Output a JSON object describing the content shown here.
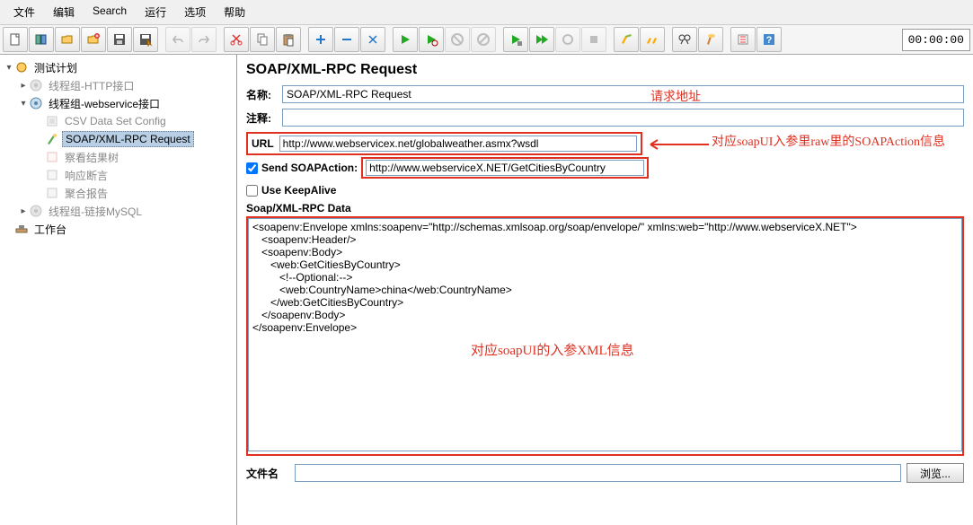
{
  "menubar": [
    "文件",
    "编辑",
    "Search",
    "运行",
    "选项",
    "帮助"
  ],
  "timer": "00:00:00",
  "tree": {
    "root": "测试计划",
    "n1": "线程组-HTTP接口",
    "n2": "线程组-webservice接口",
    "n2a": "CSV Data Set Config",
    "n2b": "SOAP/XML-RPC Request",
    "n2c": "察看结果树",
    "n2d": "响应断言",
    "n2e": "聚合报告",
    "n3": "线程组-链接MySQL",
    "n4": "工作台"
  },
  "panel": {
    "title": "SOAP/XML-RPC Request",
    "nameLabel": "名称:",
    "nameValue": "SOAP/XML-RPC Request",
    "commentLabel": "注释:",
    "commentValue": "",
    "urlLabel": "URL",
    "urlValue": "http://www.webservicex.net/globalweather.asmx?wsdl",
    "sendSoapLabel": "Send SOAPAction:",
    "soapActionValue": "http://www.webserviceX.NET/GetCitiesByCountry",
    "keepAliveLabel": "Use KeepAlive",
    "dataLabel": "Soap/XML-RPC Data",
    "dataValue": "<soapenv:Envelope xmlns:soapenv=\"http://schemas.xmlsoap.org/soap/envelope/\" xmlns:web=\"http://www.webserviceX.NET\">\n   <soapenv:Header/>\n   <soapenv:Body>\n      <web:GetCitiesByCountry>\n         <!--Optional:-->\n         <web:CountryName>china</web:CountryName>\n      </web:GetCitiesByCountry>\n   </soapenv:Body>\n</soapenv:Envelope>",
    "fileLabel": "文件名",
    "fileValue": "",
    "browseLabel": "浏览..."
  },
  "annotations": {
    "a1": "请求地址",
    "a2": "对应soapUI入参里raw里的SOAPAction信息",
    "a3": "对应soapUI的入参XML信息"
  }
}
